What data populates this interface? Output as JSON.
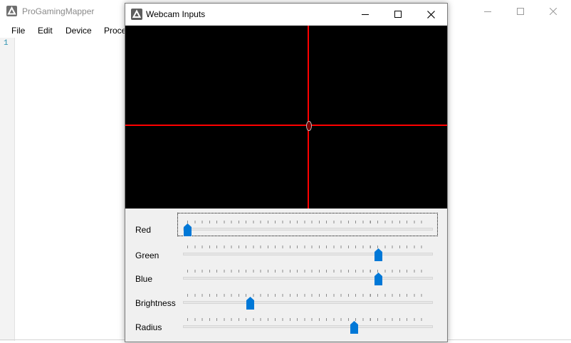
{
  "main_window": {
    "title": "ProGamingMapper",
    "menu": [
      "File",
      "Edit",
      "Device",
      "Proce"
    ],
    "editor_line_numbers": [
      "1"
    ]
  },
  "webcam_dialog": {
    "title": "Webcam Inputs",
    "icons": {
      "minimize": "minimize-icon",
      "maximize": "maximize-icon",
      "close": "close-icon"
    },
    "crosshair_color": "#ff0000",
    "sliders": [
      {
        "label": "Red",
        "value": 0.0,
        "focused": true
      },
      {
        "label": "Green",
        "value": 0.79
      },
      {
        "label": "Blue",
        "value": 0.79
      },
      {
        "label": "Brightness",
        "value": 0.26
      },
      {
        "label": "Radius",
        "value": 0.69
      }
    ]
  },
  "colors": {
    "thumb": "#0078d7",
    "crosshair": "#ff0000"
  }
}
